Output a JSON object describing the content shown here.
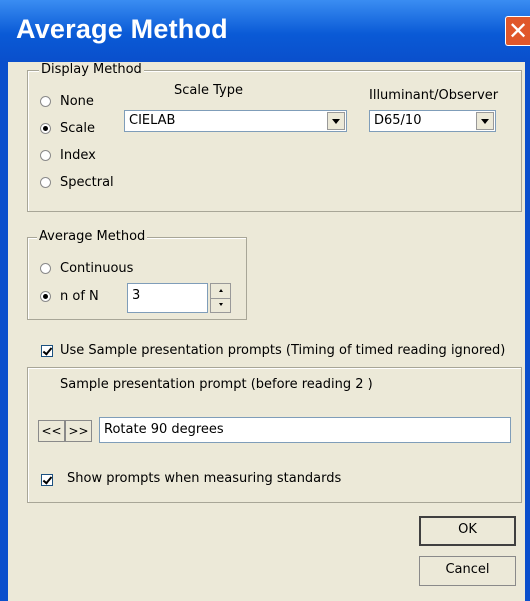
{
  "window": {
    "title": "Average Method",
    "close_glyph": "✕"
  },
  "display_method": {
    "legend": "Display Method",
    "options": [
      {
        "label": "None",
        "selected": false
      },
      {
        "label": "Scale",
        "selected": true
      },
      {
        "label": "Index",
        "selected": false
      },
      {
        "label": "Spectral",
        "selected": false
      }
    ],
    "scale_type": {
      "label": "Scale Type",
      "value": "CIELAB"
    },
    "illuminant": {
      "label": "Illuminant/Observer",
      "value": "D65/10"
    }
  },
  "average_method": {
    "legend": "Average Method",
    "options": [
      {
        "label": "Continuous",
        "selected": false
      },
      {
        "label": "n of N",
        "selected": true
      }
    ],
    "n_value": "3"
  },
  "use_prompts": {
    "label": "Use Sample presentation prompts (Timing of timed reading ignored)",
    "checked": true
  },
  "prompt_group": {
    "caption": "Sample presentation prompt (before reading 2 )",
    "prev_label": "<<",
    "next_label": ">>",
    "prompt_text": "Rotate 90 degrees",
    "show_standards": {
      "label": "Show prompts when measuring standards",
      "checked": true
    }
  },
  "buttons": {
    "ok": "OK",
    "cancel": "Cancel"
  },
  "colors": {
    "titlebar": "#0a5ad6",
    "close": "#e0572a",
    "face": "#ece9d8"
  },
  "icons": {
    "close": "close-icon",
    "spin_up": "spin-up-icon",
    "spin_down": "spin-down-icon",
    "dropdown": "chevron-down-icon"
  }
}
